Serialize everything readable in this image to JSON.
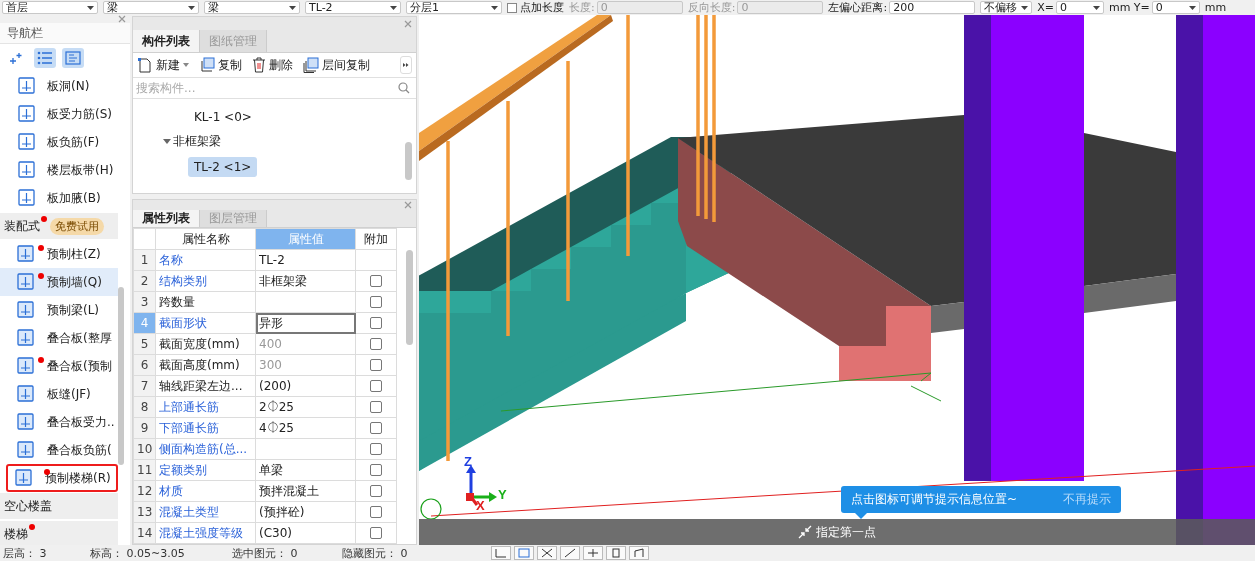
{
  "toolbar": {
    "items": [
      {
        "kind": "combo",
        "value": "首层"
      },
      {
        "kind": "combo",
        "value": "梁"
      },
      {
        "kind": "combo",
        "value": "梁"
      },
      {
        "kind": "combo",
        "value": "TL-2"
      },
      {
        "kind": "combo",
        "value": "分层1"
      },
      {
        "kind": "checkbox",
        "label": "点加长度",
        "checked": false
      },
      {
        "kind": "field",
        "label": "长度:",
        "value": "0",
        "disabled": true
      },
      {
        "kind": "field",
        "label": "反向长度:",
        "value": "0",
        "disabled": true
      },
      {
        "kind": "field",
        "label": "左偏心距离:",
        "value": "200",
        "disabled": false
      },
      {
        "kind": "dropdown",
        "value": "不偏移"
      },
      {
        "kind": "spin",
        "label": "X=",
        "value": "0"
      },
      {
        "kind": "spin",
        "label": "mm Y=",
        "value": "0"
      },
      {
        "kind": "unit",
        "label": "mm"
      }
    ]
  },
  "nav": {
    "title": "导航栏",
    "tools": [
      {
        "selected": false
      },
      {
        "selected": true
      },
      {
        "selected": true
      }
    ],
    "items": [
      {
        "kind": "item",
        "label": "板洞(N)",
        "selected": false,
        "badge": false,
        "highlighted": false
      },
      {
        "kind": "item",
        "label": "板受力筋(S)",
        "selected": false,
        "badge": false,
        "highlighted": false
      },
      {
        "kind": "item",
        "label": "板负筋(F)",
        "selected": false,
        "badge": false,
        "highlighted": false
      },
      {
        "kind": "item",
        "label": "楼层板带(H)",
        "selected": false,
        "badge": false,
        "highlighted": false
      },
      {
        "kind": "item",
        "label": "板加腋(B)",
        "selected": false,
        "badge": false,
        "highlighted": false
      },
      {
        "kind": "group",
        "label": "装配式",
        "badge": true,
        "tag": "免费试用"
      },
      {
        "kind": "item",
        "label": "预制柱(Z)",
        "selected": false,
        "badge": true,
        "highlighted": false
      },
      {
        "kind": "item",
        "label": "预制墙(Q)",
        "selected": true,
        "badge": true,
        "highlighted": false
      },
      {
        "kind": "item",
        "label": "预制梁(L)",
        "selected": false,
        "badge": false,
        "highlighted": false
      },
      {
        "kind": "item",
        "label": "叠合板(整厚",
        "selected": false,
        "badge": false,
        "highlighted": false
      },
      {
        "kind": "item",
        "label": "叠合板(预制",
        "selected": false,
        "badge": true,
        "highlighted": false
      },
      {
        "kind": "item",
        "label": "板缝(JF)",
        "selected": false,
        "badge": false,
        "highlighted": false
      },
      {
        "kind": "item",
        "label": "叠合板受力..",
        "selected": false,
        "badge": false,
        "highlighted": false
      },
      {
        "kind": "item",
        "label": "叠合板负筋(",
        "selected": false,
        "badge": false,
        "highlighted": false
      },
      {
        "kind": "item",
        "label": "预制楼梯(R)",
        "selected": false,
        "badge": true,
        "highlighted": true
      },
      {
        "kind": "group",
        "label": "空心楼盖",
        "badge": false
      },
      {
        "kind": "group",
        "label": "楼梯",
        "badge": true
      }
    ]
  },
  "components": {
    "tabs": [
      {
        "label": "构件列表",
        "selected": true
      },
      {
        "label": "图纸管理",
        "selected": false
      }
    ],
    "actions": [
      {
        "label": "新建"
      },
      {
        "label": "复制"
      },
      {
        "label": "删除"
      },
      {
        "label": "层间复制"
      }
    ],
    "search": {
      "placeholder": "搜索构件..."
    },
    "tree": [
      {
        "label": "KL-1 <0>",
        "selected": false
      },
      {
        "label": "非框架梁",
        "expanded": true,
        "children": [
          {
            "label": "TL-2 <1>",
            "selected": true
          }
        ]
      }
    ]
  },
  "properties": {
    "tabs": [
      {
        "label": "属性列表",
        "selected": true
      },
      {
        "label": "图层管理",
        "selected": false
      }
    ],
    "columns": [
      "属性名称",
      "属性值",
      "附加"
    ],
    "rows": [
      {
        "num": "1",
        "name": "名称",
        "value": "TL-2",
        "public": true,
        "greyed": false,
        "selected": false
      },
      {
        "num": "2",
        "name": "结构类别",
        "value": "非框架梁",
        "public": true,
        "greyed": false,
        "selected": false,
        "checked": false
      },
      {
        "num": "3",
        "name": "跨数量",
        "value": "",
        "public": false,
        "greyed": false,
        "selected": false,
        "checked": false
      },
      {
        "num": "4",
        "name": "截面形状",
        "value": "异形",
        "public": true,
        "greyed": false,
        "selected": true,
        "checked": false
      },
      {
        "num": "5",
        "name": "截面宽度(mm)",
        "value": "400",
        "public": false,
        "greyed": true,
        "selected": false,
        "checked": false
      },
      {
        "num": "6",
        "name": "截面高度(mm)",
        "value": "300",
        "public": false,
        "greyed": true,
        "selected": false,
        "checked": false
      },
      {
        "num": "7",
        "name": "轴线距梁左边...",
        "value": "(200)",
        "public": false,
        "greyed": false,
        "selected": false,
        "checked": false
      },
      {
        "num": "8",
        "name": "上部通长筋",
        "value": "2⏀25",
        "public": true,
        "greyed": false,
        "selected": false,
        "checked": false
      },
      {
        "num": "9",
        "name": "下部通长筋",
        "value": "4⏀25",
        "public": true,
        "greyed": false,
        "selected": false,
        "checked": false
      },
      {
        "num": "10",
        "name": "侧面构造筋(总...",
        "value": "",
        "public": true,
        "greyed": false,
        "selected": false,
        "checked": false
      },
      {
        "num": "11",
        "name": "定额类别",
        "value": "单梁",
        "public": true,
        "greyed": false,
        "selected": false,
        "checked": false
      },
      {
        "num": "12",
        "name": "材质",
        "value": "预拌混凝土",
        "public": true,
        "greyed": false,
        "selected": false,
        "checked": false
      },
      {
        "num": "13",
        "name": "混凝土类型",
        "value": "(预拌砼)",
        "public": true,
        "greyed": false,
        "selected": false,
        "checked": false
      },
      {
        "num": "14",
        "name": "混凝土强度等级",
        "value": "(C30)",
        "public": true,
        "greyed": false,
        "selected": false,
        "checked": false
      }
    ]
  },
  "viewport": {
    "axes": {
      "z": "Z",
      "y": "Y",
      "x": "X"
    },
    "tip": {
      "text": "点击图标可调节提示信息位置~",
      "dismiss": "不再提示"
    },
    "command": "指定第一点"
  },
  "status_bar": {
    "items": [
      "层高： 3",
      "标高： 0.05~3.05",
      "选中图元： 0",
      "隐藏图元： 0"
    ]
  }
}
